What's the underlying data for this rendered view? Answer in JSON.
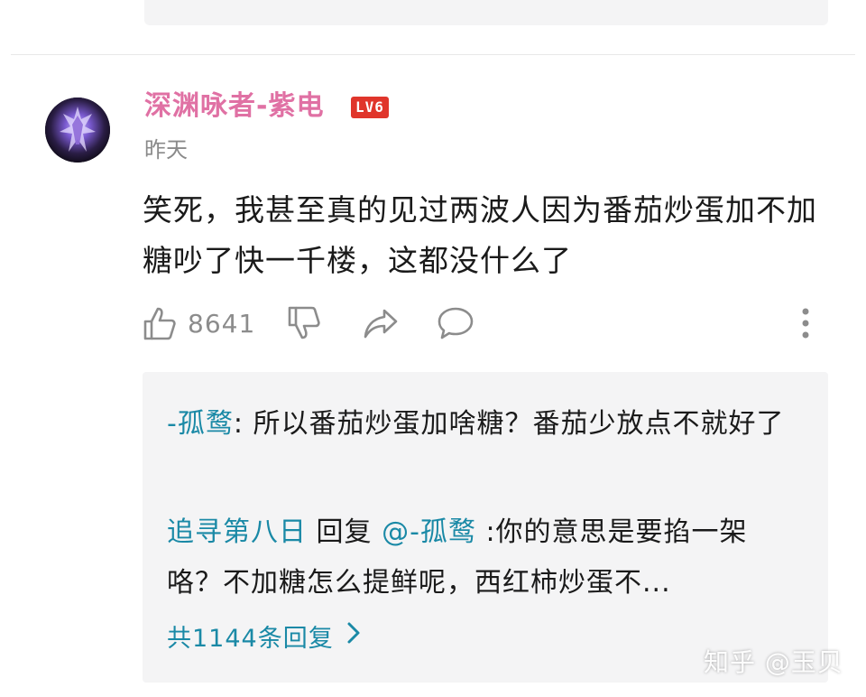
{
  "comment": {
    "author": "深渊咏者-紫电",
    "level_badge": "LV6",
    "time": "昨天",
    "body": "笑死，我甚至真的见过两波人因为番茄炒蛋加不加糖吵了快一千楼，这都没什么了",
    "likes": "8641"
  },
  "replies": [
    {
      "author": "-孤鹜",
      "separator": ": ",
      "text": "所以番茄炒蛋加啥糖？番茄少放点不就好了"
    },
    {
      "author": "追寻第八日",
      "reply_word": " 回复 ",
      "target": "@-孤鹜",
      "text": " :你的意思是要掐一架咯？不加糖怎么提鲜呢，西红柿炒蛋不..."
    }
  ],
  "view_more_label": "共1144条回复",
  "watermark": "知乎 @玉贝",
  "colors": {
    "username": "#e071a4",
    "badge": "#e0352b",
    "link": "#1a89a6",
    "muted": "#8a8a8a",
    "reply_background": "#f4f4f5"
  },
  "icons": {
    "like": "thumbs-up-icon",
    "dislike": "thumbs-down-icon",
    "share": "share-arrow-icon",
    "reply": "speech-bubble-icon",
    "more": "vertical-dots-icon",
    "expand": "chevron-right-icon"
  }
}
